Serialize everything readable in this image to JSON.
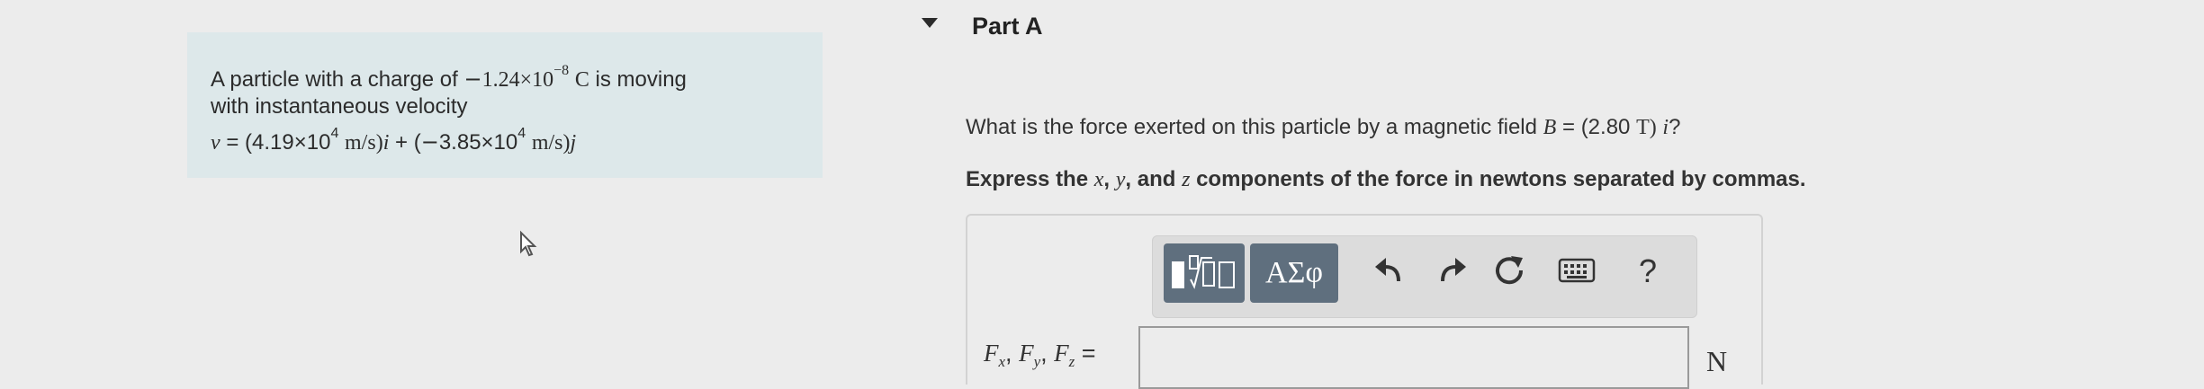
{
  "problem": {
    "text_pre": "A particle with a charge of ",
    "charge_mantissa": "1.24×10",
    "charge_exp": "−8",
    "charge_unit": "C",
    "text_post": "is moving",
    "line2": "with instantaneous velocity",
    "v_symbol": "v",
    "vx_mantissa": "(4.19×10",
    "vx_exp": "4",
    "vx_unit": "m/s)",
    "i_hat": "i",
    "vy_open": "(",
    "vy_mantissa": "3.85×10",
    "vy_exp": "4",
    "vy_unit": "m/s)",
    "j_hat": "j"
  },
  "part": {
    "title": "Part A"
  },
  "question": {
    "text": "What is the force exerted on this particle by a magnetic field ",
    "B_symbol": "B",
    "B_value": "(2.80",
    "B_unit": "T)",
    "i_hat": "i",
    "end": "?"
  },
  "instruction": {
    "pre": "Express the ",
    "x": "x",
    "sep1": ", ",
    "y": "y",
    "sep2": ", and ",
    "z": "z",
    "post": " components of the force in newtons separated by commas."
  },
  "toolbar": {
    "greek_label": "ΑΣφ",
    "help_label": "?"
  },
  "answer": {
    "F": "F",
    "x_sub": "x",
    "y_sub": "y",
    "z_sub": "z",
    "unit": "N",
    "value": ""
  },
  "colors": {
    "panel": "#dde8ea",
    "button": "#5f6f7e",
    "background": "#ececec"
  }
}
